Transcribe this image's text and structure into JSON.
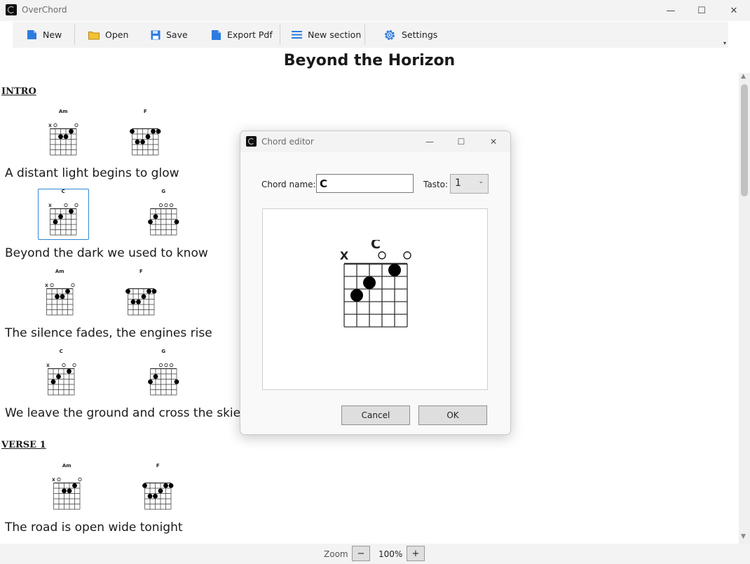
{
  "window": {
    "title": "OverChord",
    "minimize": "—",
    "maximize": "☐",
    "close": "✕"
  },
  "toolbar": {
    "new_label": "New",
    "open_label": "Open",
    "save_label": "Save",
    "export_label": "Export Pdf",
    "new_section_label": "New section",
    "settings_label": "Settings",
    "overflow": "▾"
  },
  "song": {
    "title": "Beyond the Horizon",
    "sections": [
      {
        "name": "INTRO",
        "lines": [
          {
            "lyric": "A distant light begins to glow",
            "chords": [
              "Am",
              "F"
            ]
          },
          {
            "lyric": "Beyond the dark we used to know",
            "chords": [
              "C",
              "G"
            ]
          },
          {
            "lyric": "The silence fades, the engines rise",
            "chords": [
              "Am",
              "F"
            ]
          },
          {
            "lyric": "We leave the ground and cross the skies",
            "chords": [
              "C",
              "G"
            ]
          }
        ]
      },
      {
        "name": "VERSE 1",
        "lines": [
          {
            "lyric": "The road is open wide tonight",
            "chords": [
              "Am",
              "F"
            ]
          }
        ]
      }
    ]
  },
  "chords": {
    "Am": {
      "name": "Am",
      "markers": [
        "X",
        "O",
        "",
        "",
        "",
        "O"
      ],
      "dots": [
        [
          4,
          1
        ],
        [
          2,
          2
        ],
        [
          3,
          2
        ]
      ]
    },
    "F": {
      "name": "F",
      "markers": [
        "",
        "",
        "",
        "",
        "",
        ""
      ],
      "dots": [
        [
          0,
          1
        ],
        [
          4,
          1
        ],
        [
          5,
          1
        ],
        [
          3,
          2
        ],
        [
          1,
          3
        ],
        [
          2,
          3
        ]
      ]
    },
    "C": {
      "name": "C",
      "markers": [
        "X",
        "",
        "",
        "O",
        "",
        "O"
      ],
      "dots": [
        [
          4,
          1
        ],
        [
          2,
          2
        ],
        [
          1,
          3
        ]
      ]
    },
    "G": {
      "name": "G",
      "markers": [
        "",
        "",
        "O",
        "O",
        "O",
        ""
      ],
      "dots": [
        [
          1,
          2
        ],
        [
          0,
          3
        ],
        [
          5,
          3
        ]
      ]
    }
  },
  "selected_chord": "C",
  "dialog": {
    "title": "Chord editor",
    "chord_name_label": "Chord name:",
    "chord_name_value": "C",
    "tasto_label": "Tasto:",
    "tasto_value": "1",
    "cancel_label": "Cancel",
    "ok_label": "OK",
    "minimize": "—",
    "maximize": "☐",
    "close": "✕"
  },
  "status": {
    "zoom_label": "Zoom",
    "zoom_value": "100%",
    "zoom_out": "−",
    "zoom_in": "+"
  }
}
